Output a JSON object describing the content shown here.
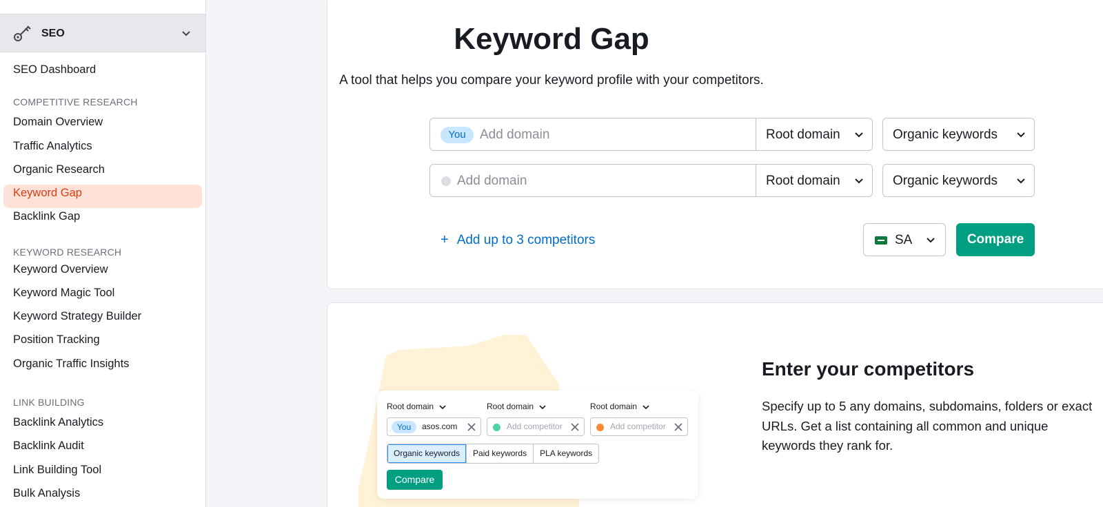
{
  "sidebar": {
    "section_label": "SEO",
    "dashboard": "SEO Dashboard",
    "groups": [
      {
        "heading": "COMPETITIVE RESEARCH",
        "items": [
          "Domain Overview",
          "Traffic Analytics",
          "Organic Research",
          "Keyword Gap",
          "Backlink Gap"
        ]
      },
      {
        "heading": "KEYWORD RESEARCH",
        "items": [
          "Keyword Overview",
          "Keyword Magic Tool",
          "Keyword Strategy Builder",
          "Position Tracking",
          "Organic Traffic Insights"
        ]
      },
      {
        "heading": "LINK BUILDING",
        "items": [
          "Backlink Analytics",
          "Backlink Audit",
          "Link Building Tool",
          "Bulk Analysis"
        ]
      }
    ],
    "active_item": "Keyword Gap"
  },
  "main": {
    "title": "Keyword Gap",
    "subtitle": "A tool that helps you compare your keyword profile with your competitors.",
    "rows": [
      {
        "badge": "You",
        "placeholder": "Add domain",
        "scope": "Root domain",
        "type": "Organic keywords"
      },
      {
        "badge": "",
        "placeholder": "Add domain",
        "scope": "Root domain",
        "type": "Organic keywords"
      }
    ],
    "add_competitors": "Add up to 3 competitors",
    "database": "SA",
    "compare": "Compare"
  },
  "promo": {
    "title": "Enter your competitors",
    "description": "Specify up to 5 any domains, subdomains, folders or exact URLs. Get a list containing all common and unique keywords they rank for.",
    "mock": {
      "scope_labels": [
        "Root domain",
        "Root domain",
        "Root domain"
      ],
      "you_badge": "You",
      "you_domain": "asos.com",
      "competitor_placeholder": "Add competitor",
      "tabs": [
        "Organic keywords",
        "Paid keywords",
        "PLA keywords"
      ],
      "compare": "Compare"
    }
  },
  "colors": {
    "accent_green": "#009f81",
    "link_blue": "#006dca",
    "active_orange": "#d93d12",
    "active_bg": "#ffe2d7",
    "dot_green": "#4fd1a5",
    "dot_orange": "#ff8a34",
    "blob": "#fff2d6"
  },
  "icons": [
    "dashboard-icon",
    "seo-key-icon",
    "chevron-down-icon",
    "plus-icon",
    "flag-sa-icon",
    "close-icon"
  ]
}
